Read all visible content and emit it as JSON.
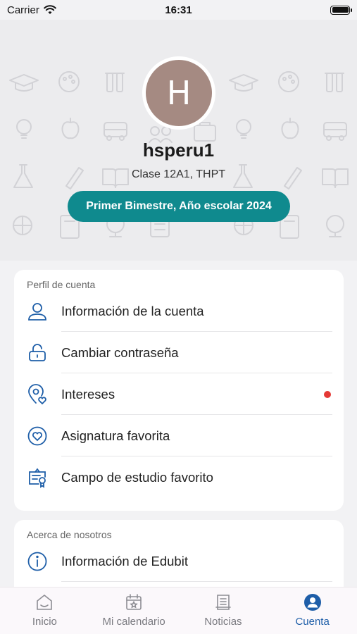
{
  "status_bar": {
    "carrier": "Carrier",
    "time": "16:31",
    "battery_level": 1.0
  },
  "profile": {
    "avatar_initial": "H",
    "avatar_color": "#a58a82",
    "username": "hsperu1",
    "class_info": "Clase 12A1, THPT",
    "period": "Primer Bimestre, Año escolar 2024",
    "period_color": "#0f8a8e"
  },
  "account_section": {
    "title": "Perfil de cuenta",
    "items": [
      {
        "label": "Información de la cuenta",
        "icon": "user-icon"
      },
      {
        "label": "Cambiar contraseña",
        "icon": "lock-icon"
      },
      {
        "label": "Intereses",
        "icon": "location-heart-icon",
        "has_notification_dot": true
      },
      {
        "label": "Asignatura favorita",
        "icon": "heart-icon"
      },
      {
        "label": "Campo de estudio favorito",
        "icon": "certificate-icon"
      }
    ]
  },
  "about_section": {
    "title": "Acerca de nosotros",
    "items": [
      {
        "label": "Información de Edubit",
        "icon": "info-icon"
      }
    ]
  },
  "tab_bar": {
    "active_color": "#1e5ea8",
    "tabs": [
      {
        "label": "Inicio",
        "icon": "home-icon",
        "active": false
      },
      {
        "label": "Mi calendario",
        "icon": "calendar-icon",
        "active": false
      },
      {
        "label": "Noticias",
        "icon": "news-icon",
        "active": false
      },
      {
        "label": "Cuenta",
        "icon": "account-icon",
        "active": true
      }
    ]
  }
}
